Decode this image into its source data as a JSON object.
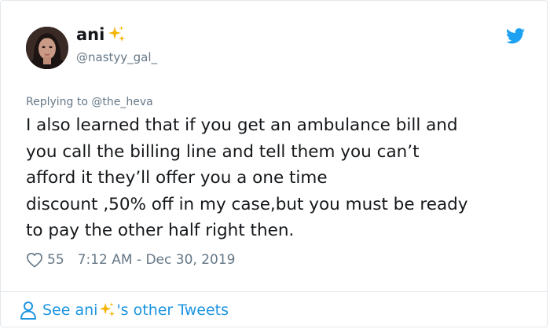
{
  "tweet": {
    "display_name": "ani",
    "handle": "@nastyy_gal_",
    "reply_prefix": "Replying to",
    "reply_to": "@the_heva",
    "text_lines": [
      "I also learned that if you get an ambulance bill and",
      "you call the billing line and tell them you can’t",
      "afford it they’ll offer you a one time",
      "discount ,50% off in my case,but you must be ready",
      "to pay the other half right then."
    ],
    "likes": "55",
    "timestamp": "7:12 AM - Dec 30, 2019"
  },
  "footer": {
    "link_prefix": "See ani",
    "link_suffix": "'s other Tweets"
  },
  "icons": {
    "sparkle": "sparkles-emoji",
    "brand": "twitter-bird-icon",
    "like": "heart-icon",
    "profile": "person-icon"
  },
  "colors": {
    "text": "#14171a",
    "muted": "#657786",
    "link": "#1b95e0",
    "brand": "#1da1f2",
    "sparkle": "#f5b400",
    "border": "#e1e8ed"
  }
}
